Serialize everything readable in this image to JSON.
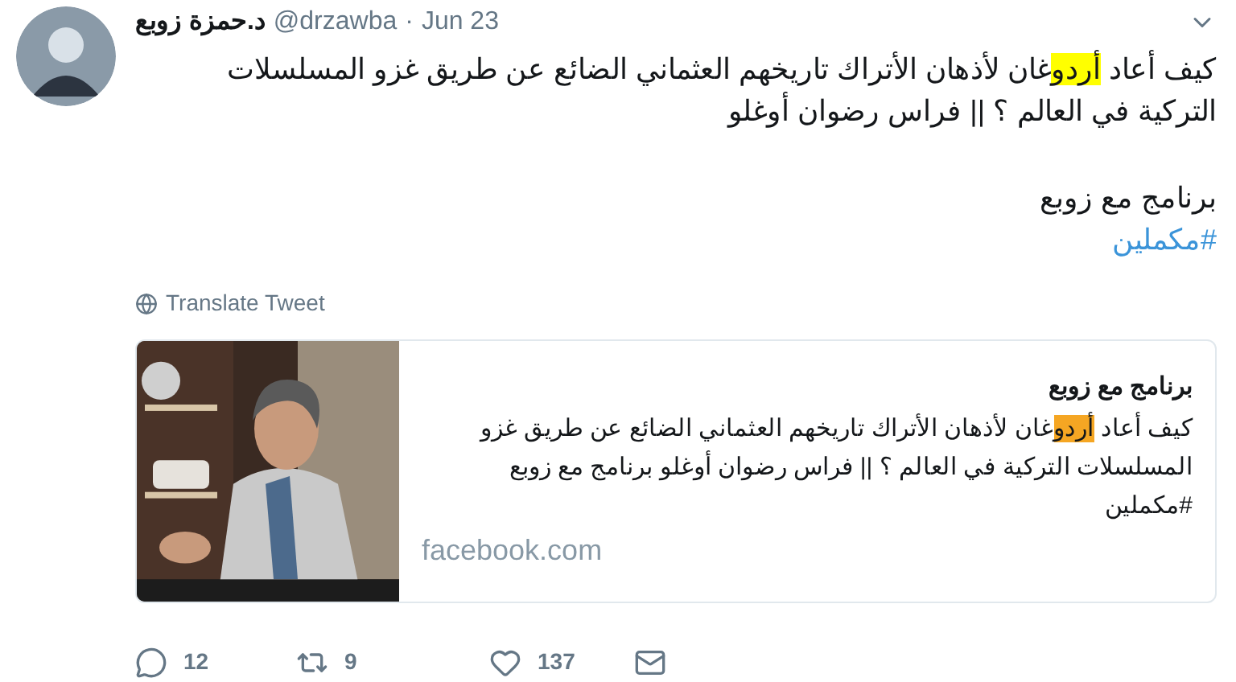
{
  "tweet": {
    "author_name": "د.حمزة زوبع",
    "handle": "@drzawba",
    "separator": "·",
    "date": "Jun 23",
    "paragraphs": [
      {
        "parts": [
          {
            "text": "كيف أعاد ",
            "highlighted": false
          },
          {
            "text": "أردو",
            "highlighted": true
          },
          {
            "text": "غان لأذهان الأتراك تاريخهم العثماني الضائع عن طريق غزو المسلسلات التركية في العالم ؟ || فراس رضوان أوغلو",
            "highlighted": false
          }
        ]
      },
      {
        "parts": [
          {
            "text": "برنامج مع زوبع",
            "highlighted": false
          }
        ]
      }
    ],
    "hashtag": "#مكملين",
    "translate": "Translate Tweet",
    "card": {
      "title": "برنامج مع زوبع",
      "parts": [
        {
          "text": "كيف أعاد ",
          "highlighted": false
        },
        {
          "text": "أردو",
          "highlighted": true
        },
        {
          "text": "غان لأذهان الأتراك تاريخهم العثماني الضائع عن طريق غزو المسلسلات التركية في العالم ؟ || فراس رضوان أوغلو برنامج مع زوبع #مكملين",
          "highlighted": false
        }
      ],
      "domain": "facebook.com"
    },
    "actions": {
      "reply_count": "12",
      "retweet_count": "9",
      "like_count": "137"
    }
  }
}
